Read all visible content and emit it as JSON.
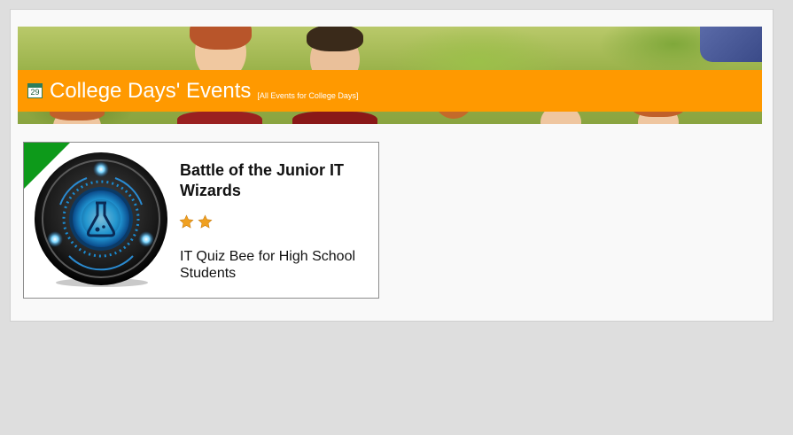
{
  "banner": {
    "calendar_day": "29",
    "title": "College Days' Events",
    "link": "[All Events for College Days]"
  },
  "events": [
    {
      "title": "Battle of the Junior IT Wizards",
      "rating": 2,
      "description": "IT Quiz Bee for High School Students",
      "image_icon": "flask-icon"
    }
  ],
  "colors": {
    "banner_bar": "#ff9900",
    "corner_ribbon": "#0d9a1a",
    "star": "#f0a020"
  }
}
